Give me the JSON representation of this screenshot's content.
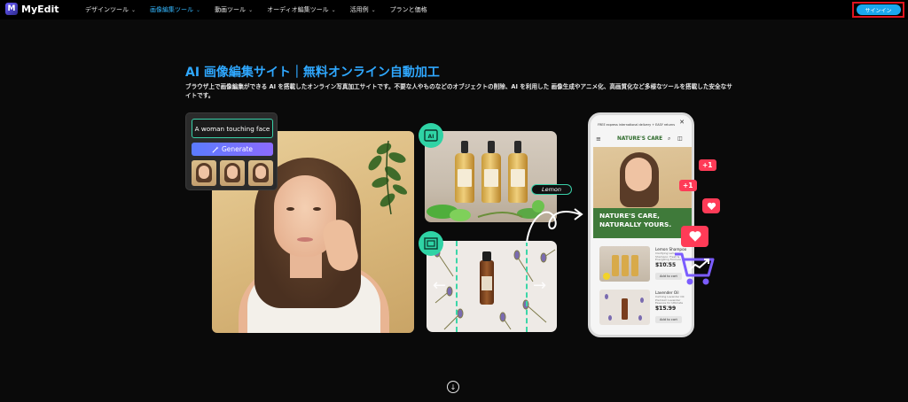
{
  "nav": {
    "logo_text": "MyEdit",
    "items": [
      {
        "label": "デザインツール",
        "active": false
      },
      {
        "label": "画像編集ツール",
        "active": true
      },
      {
        "label": "動画ツール",
        "active": false
      },
      {
        "label": "オーディオ編集ツール",
        "active": false
      },
      {
        "label": "活用例",
        "active": false
      },
      {
        "label": "プランと価格",
        "active": false
      }
    ],
    "signin_label": "サインイン"
  },
  "hero": {
    "title": "AI 画像編集サイト｜無料オンライン自動加工",
    "description": "ブラウザ上で画像編集ができる AI を搭載したオンライン写真加工サイトです。不要な人やものなどのオブジェクトの削除、AI を利用した 画像生成やアニメ化、高画質化など多様なツールを搭載した安全なサイトです。"
  },
  "prompt_card": {
    "input_value": "A woman touching face",
    "generate_label": "Generate"
  },
  "product_demo": {
    "lemon_tag": "Lemon"
  },
  "phone": {
    "banner": "FREE express international delivery + EASY returns",
    "brand": "NATURE'S CARE",
    "hero_line1": "NATURE'S CARE,",
    "hero_line2": "NATURALLY YOURS.",
    "products": [
      {
        "name": "Lemon Shampoo",
        "desc": "Clarifying Lemon Shampoo: Fresh & Energizing Formula for Vibrant Hair",
        "price": "$10.55",
        "cart": "Add to cart"
      },
      {
        "name": "Lavender Oil",
        "desc": "Calming Lavender Oil: Premium Lavender Essence for Ultimate Relaxation",
        "price": "$15.99",
        "cart": "Add to cart"
      }
    ]
  },
  "social": {
    "plus1_a": "+1",
    "plus1_b": "+1"
  },
  "colors": {
    "accent": "#2fa8ff",
    "signin": "#1aa7ee",
    "highlight_border": "#e0141e",
    "teal": "#2fd3a5",
    "generate_gradient": [
      "#5b7bff",
      "#8b6bff"
    ],
    "badge_red": "#ff3b57"
  },
  "icons": [
    "myedit-logo-icon",
    "chevron-down-icon",
    "magic-wand-icon",
    "ai-generate-icon",
    "crop-frame-icon",
    "arrow-left-icon",
    "arrow-right-icon",
    "curved-arrow-icon",
    "close-icon",
    "menu-icon",
    "search-icon",
    "bag-icon",
    "heart-icon",
    "shopping-cart-icon",
    "trend-up-icon",
    "scroll-down-icon"
  ]
}
